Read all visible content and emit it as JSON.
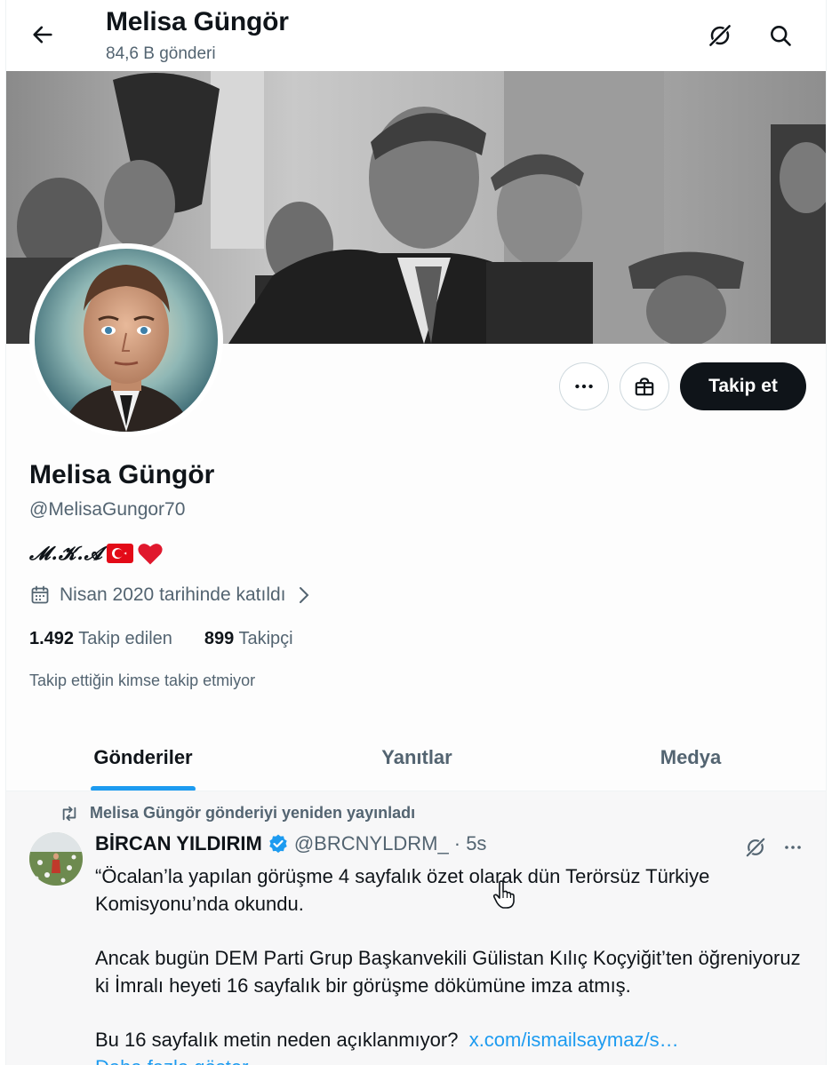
{
  "header": {
    "title": "Melisa Güngör",
    "post_count": "84,6 B gönderi"
  },
  "profile": {
    "name": "Melisa Güngör",
    "handle": "@MelisaGungor70",
    "bio": "𝓜.𝓚.𝓐",
    "bio_emojis": [
      "turkey-flag",
      "red-heart"
    ],
    "joined": "Nisan 2020 tarihinde katıldı",
    "following_count": "1.492",
    "following_label": "Takip edilen",
    "followers_count": "899",
    "followers_label": "Takipçi",
    "followed_by": "Takip ettiğin kimse takip etmiyor",
    "follow_button": "Takip et"
  },
  "tabs": [
    {
      "label": "Gönderiler",
      "active": true
    },
    {
      "label": "Yanıtlar",
      "active": false
    },
    {
      "label": "Medya",
      "active": false
    }
  ],
  "post": {
    "repost_label": "Melisa Güngör gönderiyi yeniden yayınladı",
    "author": "BİRCAN YILDIRIM",
    "verified": true,
    "handle": "@BRCNYLDRM_",
    "time": "· 5s",
    "paragraph1": "“Öcalan’la yapılan görüşme 4 sayfalık özet olarak dün Terörsüz Türkiye Komisyonu’nda okundu.",
    "paragraph2": "Ancak bugün DEM Parti Grup Başkanvekili Gülistan Kılıç Koçyiğit’ten öğreniyoruz ki İmralı heyeti 16 sayfalık bir görüşme dökümüne imza atmış.",
    "paragraph3": "Bu 16 sayfalık metin neden açıklanmıyor?",
    "link": "x.com/ismailsaymaz/s…",
    "show_more": "Daha fazla göster"
  },
  "colors": {
    "accent": "#1d9bf0",
    "text": "#0f1419",
    "muted": "#536471",
    "button_dark": "#0f1419"
  },
  "icons": [
    "back-arrow-icon",
    "grok-icon",
    "search-icon",
    "more-icon",
    "gift-icon",
    "calendar-icon",
    "chevron-right-icon",
    "repost-icon",
    "verified-badge-icon",
    "pointer-cursor-icon"
  ]
}
